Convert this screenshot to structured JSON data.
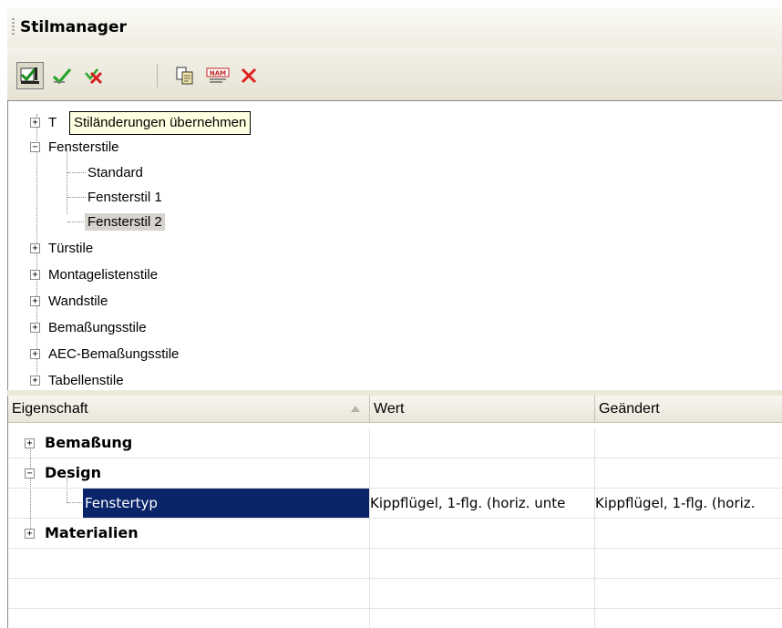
{
  "panel": {
    "title": "Stilmanager"
  },
  "toolbar": {
    "buttons": [
      {
        "icon": "apply-style-changes-icon"
      },
      {
        "icon": "apply-all-changes-icon"
      },
      {
        "icon": "discard-changes-icon"
      },
      {
        "icon": "copy-style-icon"
      },
      {
        "icon": "rename-style-icon"
      },
      {
        "icon": "delete-style-icon"
      }
    ]
  },
  "tooltip": {
    "text": "Stiländerungen übernehmen"
  },
  "tree": {
    "items": [
      {
        "label": "T",
        "expanded": false
      },
      {
        "label": "Fensterstile",
        "expanded": true
      },
      {
        "label": "Standard"
      },
      {
        "label": "Fensterstil 1"
      },
      {
        "label": "Fensterstil 2",
        "selected": true
      },
      {
        "label": "Türstile",
        "expanded": false
      },
      {
        "label": "Montagelistenstile",
        "expanded": false
      },
      {
        "label": "Wandstile",
        "expanded": false
      },
      {
        "label": "Bemaßungsstile",
        "expanded": false
      },
      {
        "label": "AEC-Bemaßungsstile",
        "expanded": false
      },
      {
        "label": "Tabellenstile",
        "expanded": false
      }
    ]
  },
  "grid": {
    "columns": [
      "Eigenschaft",
      "Wert",
      "Geändert"
    ],
    "rows": [
      {
        "name": "Bemaßung",
        "value": "",
        "changed": "",
        "expanded": false
      },
      {
        "name": "Design",
        "value": "",
        "changed": "",
        "expanded": true
      },
      {
        "name": "Fenstertyp",
        "value": "Kippflügel, 1-flg. (horiz. unte",
        "changed": "Kippflügel, 1-flg. (horiz.",
        "selected": true
      },
      {
        "name": "Materialien",
        "value": "",
        "changed": "",
        "expanded": false
      }
    ]
  },
  "colors": {
    "selection": "#0a246a",
    "tooltip_bg": "#ffffe1",
    "panel_bg": "#ece9d8"
  }
}
